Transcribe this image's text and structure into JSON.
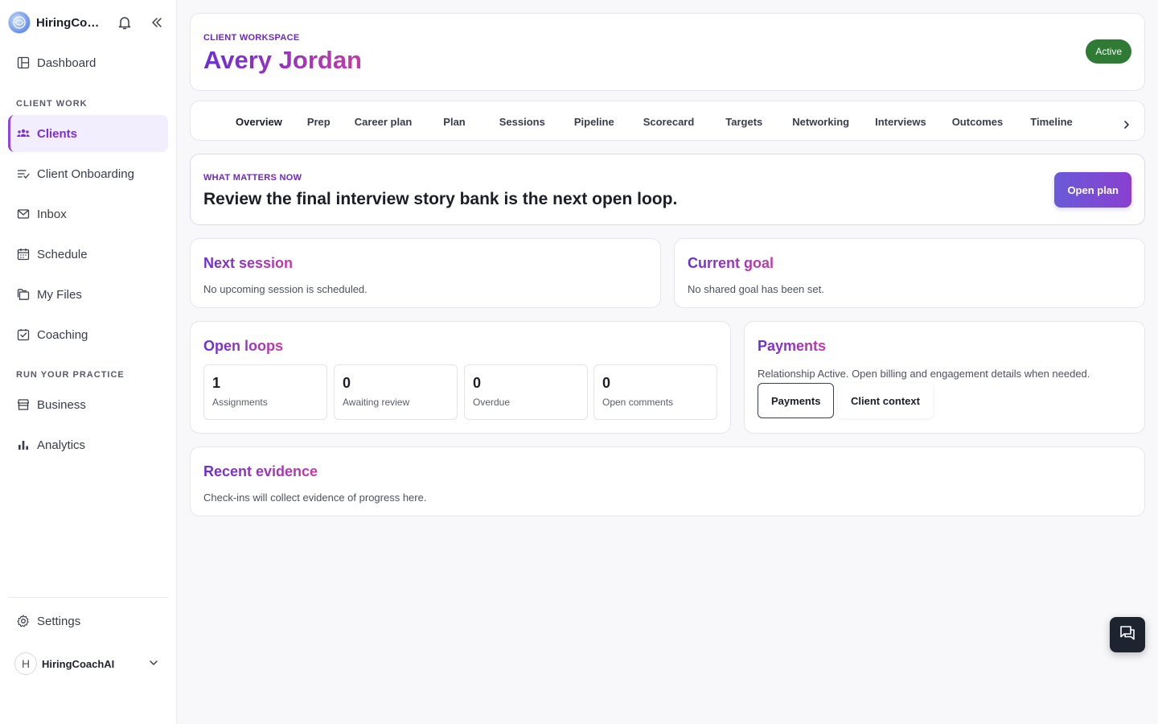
{
  "brand": {
    "name": "HiringCoachAI"
  },
  "sidebar": {
    "dashboard": "Dashboard",
    "section_client_work": "CLIENT WORK",
    "clients": "Clients",
    "client_onboarding": "Client Onboarding",
    "inbox": "Inbox",
    "schedule": "Schedule",
    "my_files": "My Files",
    "coaching": "Coaching",
    "section_practice": "RUN YOUR PRACTICE",
    "business": "Business",
    "analytics": "Analytics",
    "settings": "Settings",
    "user": {
      "initial": "H",
      "name": "HiringCoachAI"
    }
  },
  "header": {
    "eyebrow": "CLIENT WORKSPACE",
    "client_name": "Avery Jordan",
    "status": "Active",
    "status_color": "#2f7a35"
  },
  "tabs": [
    "Overview",
    "Prep",
    "Career plan",
    "Plan",
    "Sessions",
    "Pipeline",
    "Scorecard",
    "Targets",
    "Networking",
    "Interviews",
    "Outcomes",
    "Timeline"
  ],
  "active_tab": "Overview",
  "matters": {
    "eyebrow": "WHAT MATTERS NOW",
    "headline": "Review the final interview story bank is the next open loop.",
    "button": "Open plan"
  },
  "next_session": {
    "title": "Next session",
    "text": "No upcoming session is scheduled."
  },
  "current_goal": {
    "title": "Current goal",
    "text": "No shared goal has been set."
  },
  "open_loops": {
    "title": "Open loops",
    "stats": [
      {
        "value": "1",
        "label": "Assignments"
      },
      {
        "value": "0",
        "label": "Awaiting review"
      },
      {
        "value": "0",
        "label": "Overdue"
      },
      {
        "value": "0",
        "label": "Open comments"
      }
    ]
  },
  "payments": {
    "title": "Payments",
    "text": "Relationship Active. Open billing and engagement details when needed.",
    "btn_payments": "Payments",
    "btn_context": "Client context"
  },
  "evidence": {
    "title": "Recent evidence",
    "text": "Check-ins will collect evidence of progress here."
  },
  "colors": {
    "accent": "#7a2ee0",
    "gradient_start": "#6a2fd6",
    "gradient_end": "#c53aa6"
  }
}
